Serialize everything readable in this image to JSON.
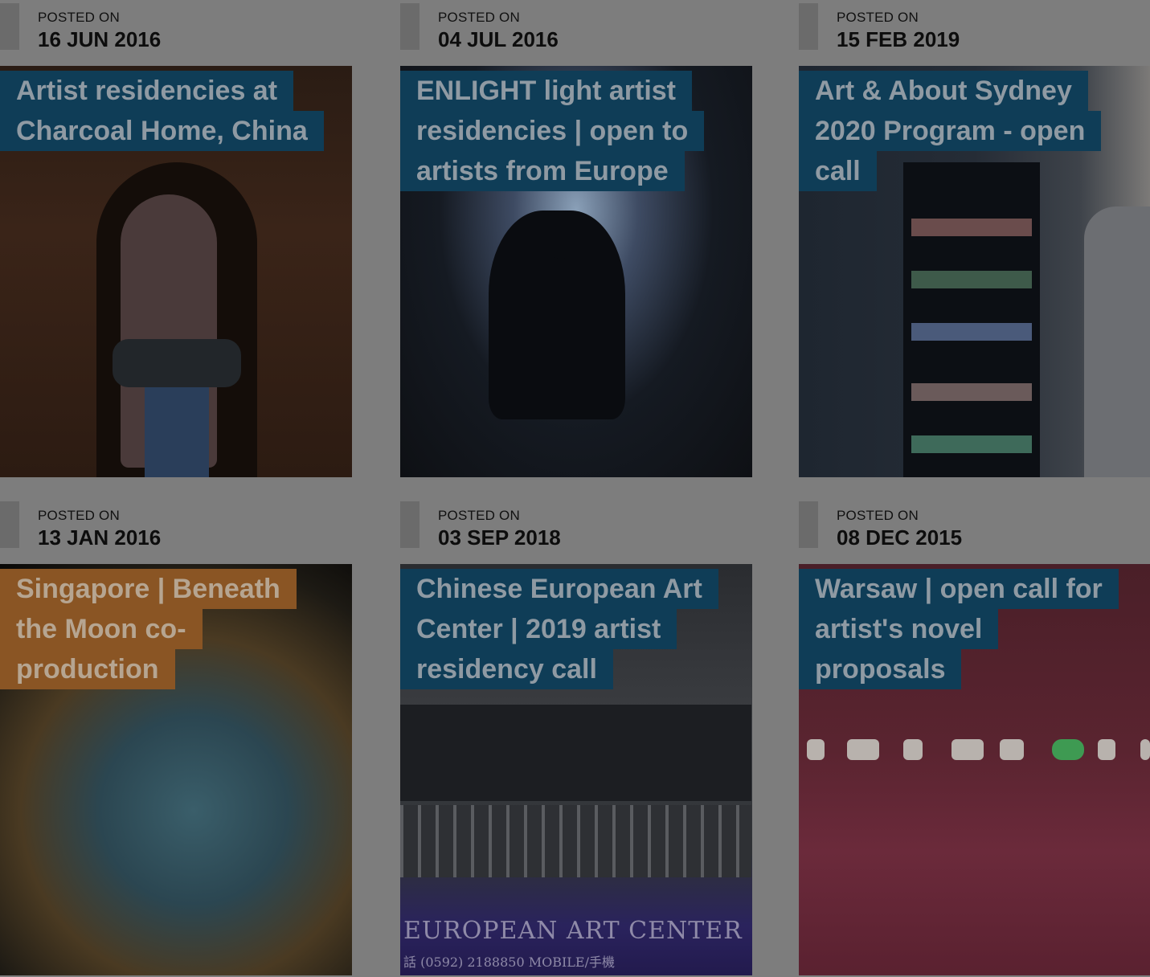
{
  "posts": [
    {
      "posted_label": "POSTED ON",
      "date": "16 JUN 2016",
      "title_lines": [
        "Artist residencies at",
        "Charcoal Home, China"
      ],
      "image": "woman-carrying-charcoal",
      "accent": "#0f3d57"
    },
    {
      "posted_label": "POSTED ON",
      "date": "04 JUL 2016",
      "title_lines": [
        "ENLIGHT light artist",
        "residencies | open to",
        "artists from Europe"
      ],
      "image": "light-tunnel-silhouette",
      "accent": "#0f3d57"
    },
    {
      "posted_label": "POSTED ON",
      "date": "15 FEB 2019",
      "title_lines": [
        "Art & About Sydney",
        "2020 Program - open",
        "call"
      ],
      "image": "vending-machine-woman",
      "accent": "#0f3d57"
    },
    {
      "posted_label": "POSTED ON",
      "date": "13 JAN 2016",
      "title_lines": [
        "Singapore | Beneath",
        "the Moon co-",
        "production"
      ],
      "image": "globe-artwork",
      "accent": "#8a5524"
    },
    {
      "posted_label": "POSTED ON",
      "date": "03 SEP 2018",
      "title_lines": [
        "Chinese European Art",
        "Center | 2019 artist",
        "residency call"
      ],
      "image": "european-art-center-building",
      "accent": "#0f3d57",
      "sign_text": "EUROPEAN ART CENTER",
      "sign_sub": "話 (0592) 2188850   MOBILE/手機"
    },
    {
      "posted_label": "POSTED ON",
      "date": "08 DEC 2015",
      "title_lines": [
        "Warsaw | open call for",
        "artist's novel",
        "proposals"
      ],
      "image": "tv-installation-red-room",
      "accent": "#0f3d57"
    }
  ]
}
